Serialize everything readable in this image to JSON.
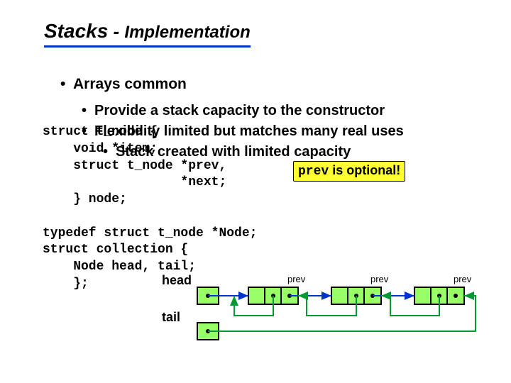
{
  "title": {
    "main": "Stacks",
    "sep": " - ",
    "sub": "Implementation"
  },
  "bullets": {
    "lv1": "Arrays common",
    "lv2a": "Provide a stack capacity to the constructor",
    "lv2b": "Flexibility limited but matches many real uses",
    "lv3": "Stack created with limited capacity"
  },
  "code": {
    "l1": "struct t_node {",
    "l2": "    void *item;",
    "l3": "    struct t_node *prev,",
    "l4": "                  *next;",
    "l5": "    } node;",
    "l6": "",
    "l7": "typedef struct t_node *Node;",
    "l8": "struct collection {",
    "l9": "    Node head, tail;",
    "l10": "    };"
  },
  "callout": {
    "prefix": "prev",
    "rest": " is optional!"
  },
  "labels": {
    "head": "head",
    "tail": "tail",
    "prev1": "prev",
    "prev2": "prev",
    "prev3": "prev"
  }
}
